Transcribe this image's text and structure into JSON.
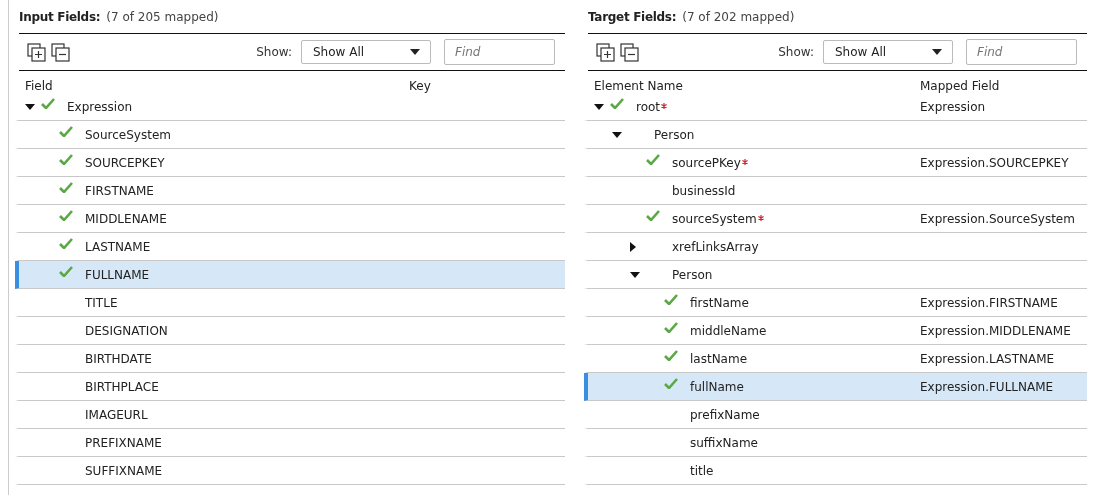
{
  "panels": [
    {
      "title": "Input Fields:",
      "count": "(7 of 205 mapped)",
      "show_label": "Show:",
      "show_value": "Show All",
      "find_placeholder": "Find",
      "columns": [
        "Field",
        "Key"
      ],
      "rows": [
        {
          "name": "Expression",
          "mapped": true,
          "required": false,
          "expanded": true,
          "selected": false,
          "children": [
            {
              "name": "SourceSystem",
              "mapped": true,
              "required": false,
              "selected": false
            },
            {
              "name": "SOURCEPKEY",
              "mapped": true,
              "required": false,
              "selected": false
            },
            {
              "name": "FIRSTNAME",
              "mapped": true,
              "required": false,
              "selected": false
            },
            {
              "name": "MIDDLENAME",
              "mapped": true,
              "required": false,
              "selected": false
            },
            {
              "name": "LASTNAME",
              "mapped": true,
              "required": false,
              "selected": false
            },
            {
              "name": "FULLNAME",
              "mapped": true,
              "required": false,
              "selected": true
            },
            {
              "name": "TITLE",
              "mapped": false,
              "required": false,
              "selected": false
            },
            {
              "name": "DESIGNATION",
              "mapped": false,
              "required": false,
              "selected": false
            },
            {
              "name": "BIRTHDATE",
              "mapped": false,
              "required": false,
              "selected": false
            },
            {
              "name": "BIRTHPLACE",
              "mapped": false,
              "required": false,
              "selected": false
            },
            {
              "name": "IMAGEURL",
              "mapped": false,
              "required": false,
              "selected": false
            },
            {
              "name": "PREFIXNAME",
              "mapped": false,
              "required": false,
              "selected": false
            },
            {
              "name": "SUFFIXNAME",
              "mapped": false,
              "required": false,
              "selected": false
            }
          ]
        }
      ]
    },
    {
      "title": "Target Fields:",
      "count": "(7 of 202 mapped)",
      "show_label": "Show:",
      "show_value": "Show All",
      "find_placeholder": "Find",
      "columns": [
        "Element Name",
        "Mapped Field"
      ],
      "rows": [
        {
          "name": "root",
          "mapped": true,
          "required": true,
          "expanded": true,
          "selected": false,
          "value": "Expression",
          "children": [
            {
              "name": "Person",
              "mapped": false,
              "required": false,
              "expanded": true,
              "selected": false,
              "children": [
                {
                  "name": "sourcePKey",
                  "mapped": true,
                  "required": true,
                  "selected": false,
                  "value": "Expression.SOURCEPKEY"
                },
                {
                  "name": "businessId",
                  "mapped": false,
                  "required": false,
                  "selected": false
                },
                {
                  "name": "sourceSystem",
                  "mapped": true,
                  "required": true,
                  "selected": false,
                  "value": "Expression.SourceSystem"
                },
                {
                  "name": "xrefLinksArray",
                  "mapped": false,
                  "required": false,
                  "expanded": false,
                  "selected": false
                },
                {
                  "name": "Person",
                  "mapped": false,
                  "required": false,
                  "expanded": true,
                  "selected": false,
                  "children": [
                    {
                      "name": "firstName",
                      "mapped": true,
                      "required": false,
                      "selected": false,
                      "value": "Expression.FIRSTNAME"
                    },
                    {
                      "name": "middleName",
                      "mapped": true,
                      "required": false,
                      "selected": false,
                      "value": "Expression.MIDDLENAME"
                    },
                    {
                      "name": "lastName",
                      "mapped": true,
                      "required": false,
                      "selected": false,
                      "value": "Expression.LASTNAME"
                    },
                    {
                      "name": "fullName",
                      "mapped": true,
                      "required": false,
                      "selected": true,
                      "value": "Expression.FULLNAME"
                    },
                    {
                      "name": "prefixName",
                      "mapped": false,
                      "required": false,
                      "selected": false
                    },
                    {
                      "name": "suffixName",
                      "mapped": false,
                      "required": false,
                      "selected": false
                    },
                    {
                      "name": "title",
                      "mapped": false,
                      "required": false,
                      "selected": false
                    }
                  ]
                }
              ]
            }
          ]
        }
      ]
    }
  ]
}
